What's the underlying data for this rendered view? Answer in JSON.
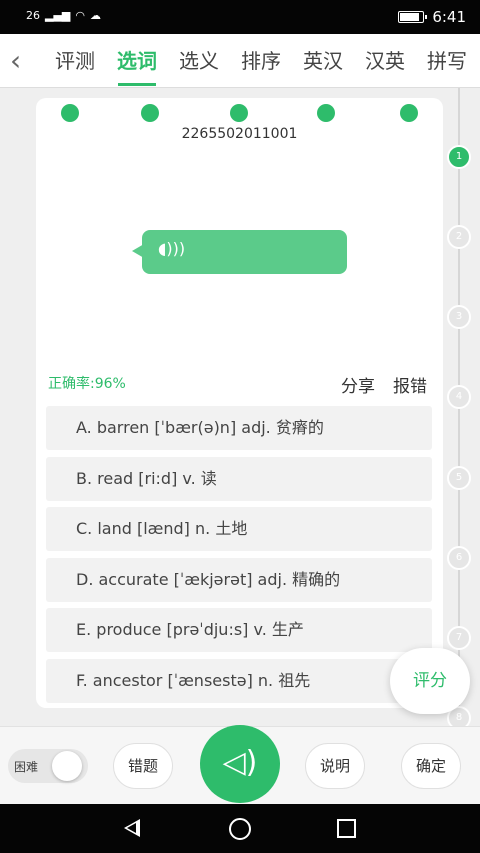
{
  "status": {
    "signal": "26",
    "time": "6:41",
    "battery_level": 0.9
  },
  "tabs": [
    {
      "label": "评测",
      "active": false
    },
    {
      "label": "选词",
      "active": true
    },
    {
      "label": "选义",
      "active": false
    },
    {
      "label": "排序",
      "active": false
    },
    {
      "label": "英汉",
      "active": false
    },
    {
      "label": "汉英",
      "active": false
    },
    {
      "label": "拼写",
      "active": false
    }
  ],
  "progress_steps": [
    "1",
    "2",
    "3",
    "4",
    "5",
    "6",
    "7",
    "8"
  ],
  "active_step": 1,
  "question": {
    "id": "2265502011001",
    "accuracy_label": "正确率:",
    "accuracy_value": "96%",
    "share_label": "分享",
    "report_label": "报错",
    "options": [
      "A. barren [ˈbær(ə)n] adj. 贫瘠的",
      "B. read [ri:d] v. 读",
      "C. land [lænd] n. 土地",
      "D. accurate [ˈækjərət] adj. 精确的",
      "E. produce [prəˈdju:s] v. 生产",
      "F. ancestor [ˈænsestə] n. 祖先"
    ]
  },
  "score_button": "评分",
  "bottom": {
    "difficulty_label": "困难",
    "mistakes_label": "错题",
    "explain_label": "说明",
    "confirm_label": "确定"
  },
  "colors": {
    "accent": "#2ebc6b",
    "bubble": "#5bcb8a"
  },
  "icons": {
    "back": "chevron-left-icon",
    "speaker": "speaker-icon",
    "bubble": "sound-wave-icon"
  }
}
